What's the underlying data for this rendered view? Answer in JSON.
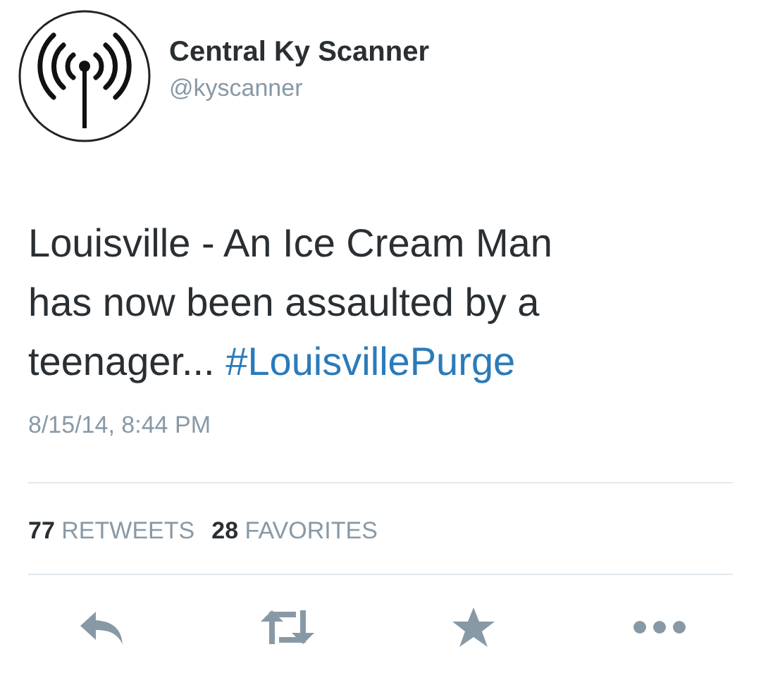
{
  "author": {
    "name": "Central Ky Scanner",
    "handle": "@kyscanner"
  },
  "tweet": {
    "text": "Louisville - An Ice Cream Man has now been assaulted by a teenager...",
    "hashtag": "#LouisvillePurge"
  },
  "timestamp": "8/15/14, 8:44 PM",
  "stats": [
    {
      "count": "77",
      "label": "RETWEETS"
    },
    {
      "count": "28",
      "label": "FAVORITES"
    }
  ],
  "actions": [
    {
      "kind": "reply"
    },
    {
      "kind": "retweet"
    },
    {
      "kind": "favorite"
    },
    {
      "kind": "more"
    }
  ]
}
